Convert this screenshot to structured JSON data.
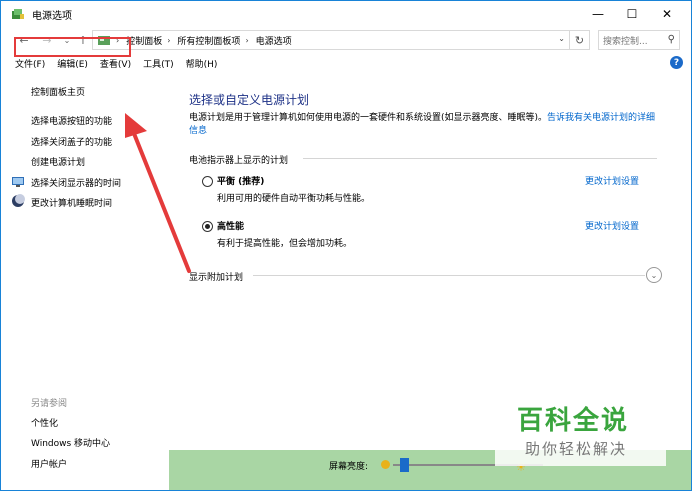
{
  "window": {
    "title": "电源选项",
    "controls": {
      "minimize": "—",
      "maximize": "☐",
      "close": "✕"
    }
  },
  "address": {
    "crumbs": [
      "控制面板",
      "所有控制面板项",
      "电源选项"
    ],
    "search_placeholder": "搜索控制..."
  },
  "menu": [
    "文件(F)",
    "编辑(E)",
    "查看(V)",
    "工具(T)",
    "帮助(H)"
  ],
  "sidebar": {
    "items": [
      {
        "label": "控制面板主页",
        "icon": ""
      },
      {
        "label": "选择电源按钮的功能",
        "icon": ""
      },
      {
        "label": "选择关闭盖子的功能",
        "icon": ""
      },
      {
        "label": "创建电源计划",
        "icon": ""
      },
      {
        "label": "选择关闭显示器的时间",
        "icon": "monitor-icon"
      },
      {
        "label": "更改计算机睡眠时间",
        "icon": "moon-icon"
      }
    ],
    "see_also_label": "另请参阅",
    "see_also": [
      "个性化",
      "Windows 移动中心",
      "用户帐户"
    ]
  },
  "main": {
    "title": "选择或自定义电源计划",
    "description": "电源计划是用于管理计算机如何使用电源的一套硬件和系统设置(如显示器亮度、睡眠等)。",
    "description_link": "告诉我有关电源计划的详细信息",
    "battery_section": "电池指示器上显示的计划",
    "plans": [
      {
        "name": "平衡 (推荐)",
        "desc": "利用可用的硬件自动平衡功耗与性能。",
        "link": "更改计划设置",
        "selected": false
      },
      {
        "name": "高性能",
        "desc": "有利于提高性能，但会增加功耗。",
        "link": "更改计划设置",
        "selected": true
      }
    ],
    "extra_section": "显示附加计划"
  },
  "status": {
    "brightness_label": "屏幕亮度:"
  },
  "watermark": {
    "title": "百科全说",
    "subtitle": "助你轻松解决"
  },
  "colors": {
    "title_blue": "#1e3287",
    "link_blue": "#0066cc",
    "highlight_red": "#e43b3b",
    "watermark_green": "#3aa53e"
  }
}
